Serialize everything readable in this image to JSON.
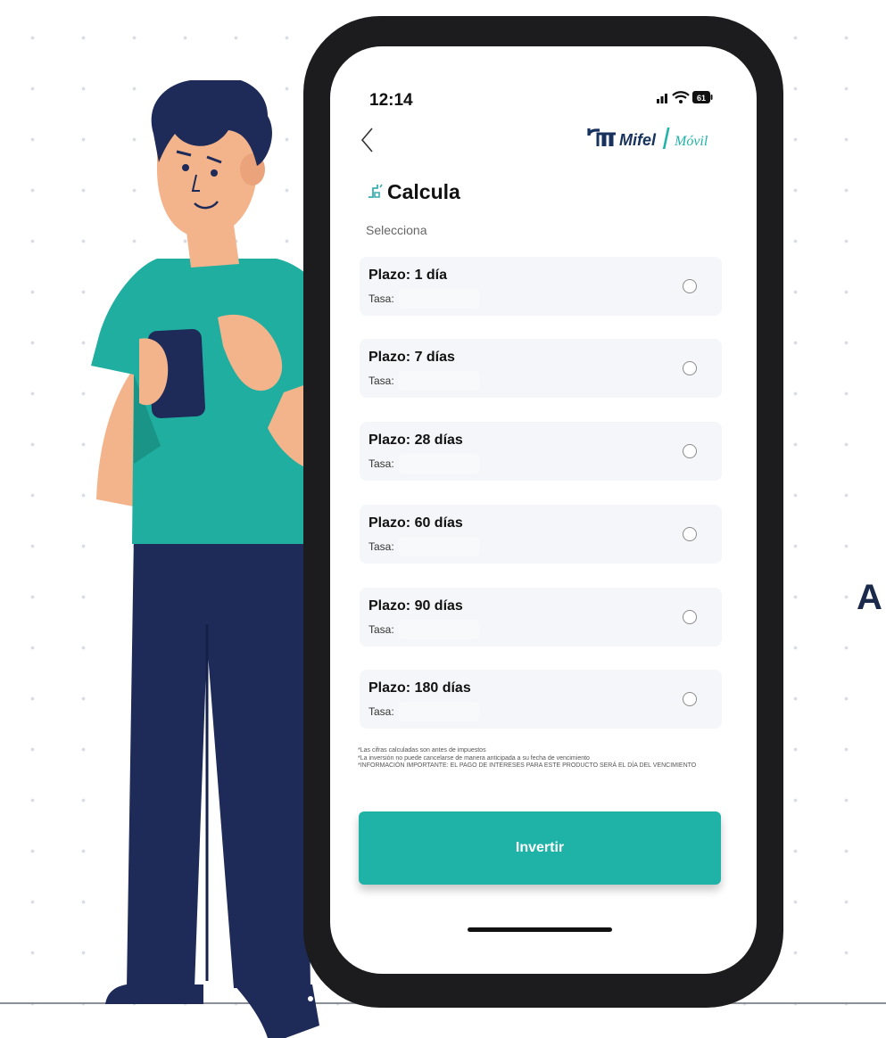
{
  "status_bar": {
    "time": "12:14",
    "battery": "61"
  },
  "header": {
    "logo_brand": "Mifel",
    "logo_suffix": "Móvil"
  },
  "section": {
    "title": "Calcula",
    "subtitle": "Selecciona"
  },
  "options": [
    {
      "label": "Plazo: 1 día",
      "rate_label": "Tasa:"
    },
    {
      "label": "Plazo: 7 días",
      "rate_label": "Tasa:"
    },
    {
      "label": "Plazo: 28 días",
      "rate_label": "Tasa:"
    },
    {
      "label": "Plazo: 60 días",
      "rate_label": "Tasa:"
    },
    {
      "label": "Plazo: 90 días",
      "rate_label": "Tasa:"
    },
    {
      "label": "Plazo: 180 días",
      "rate_label": "Tasa:"
    }
  ],
  "disclaimer": [
    "*Las cifras calculadas son antes de impuestos",
    "*La inversión no puede cancelarse de manera anticipada a su fecha de vencimiento",
    "*INFORMACIÓN IMPORTANTE: EL PAGO DE INTERESES PARA ESTE PRODUCTO SERÁ EL DÍA DEL VENCIMIENTO"
  ],
  "cta": {
    "label": "Invertir"
  },
  "side_text": "A",
  "colors": {
    "accent": "#1fb3a8",
    "navy": "#1b2a4a",
    "card": "#f4f6f9"
  }
}
